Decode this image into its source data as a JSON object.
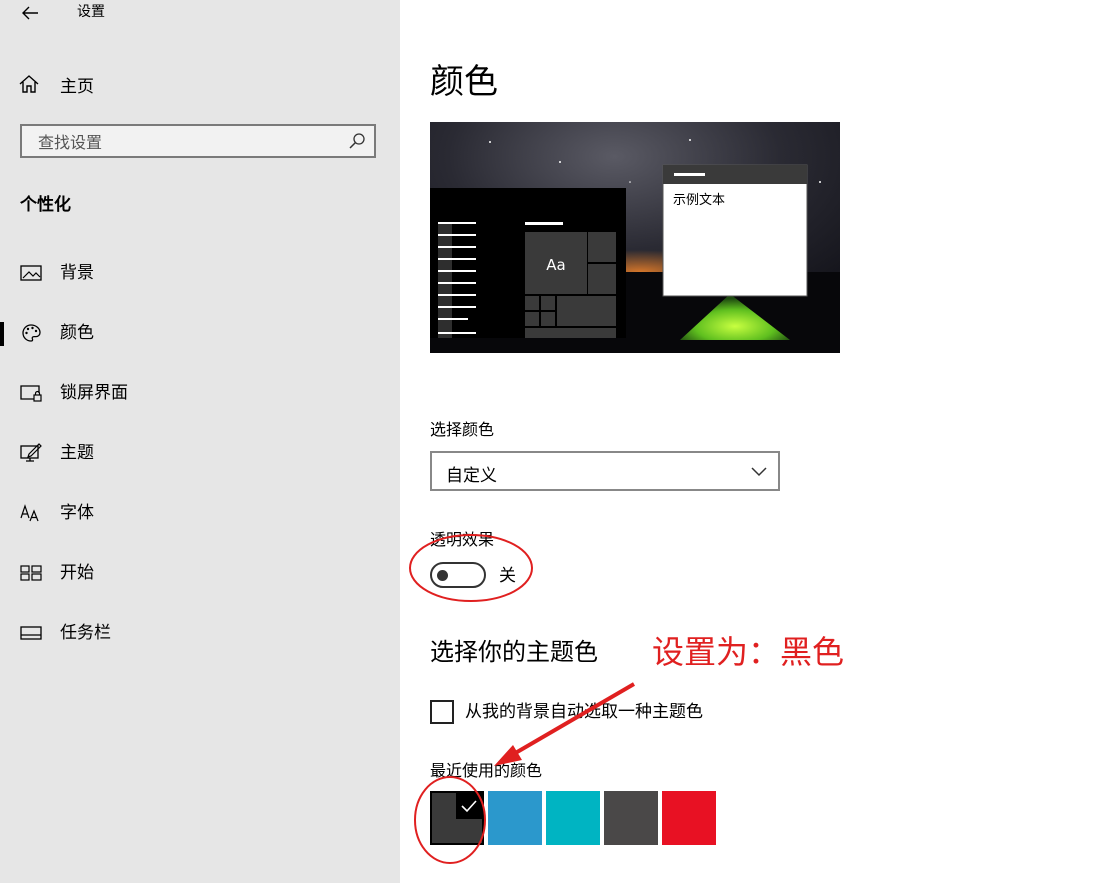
{
  "window": {
    "title": "设置"
  },
  "sidebar": {
    "home_label": "主页",
    "search_placeholder": "查找设置",
    "section_title": "个性化",
    "items": [
      {
        "label": "背景",
        "icon": "image-icon"
      },
      {
        "label": "颜色",
        "icon": "palette-icon",
        "selected": true
      },
      {
        "label": "锁屏界面",
        "icon": "lock-screen-icon"
      },
      {
        "label": "主题",
        "icon": "theme-icon"
      },
      {
        "label": "字体",
        "icon": "font-icon"
      },
      {
        "label": "开始",
        "icon": "start-icon"
      },
      {
        "label": "任务栏",
        "icon": "taskbar-icon"
      }
    ]
  },
  "main": {
    "title": "颜色",
    "preview": {
      "sample_text": "示例文本",
      "tile_text": "Aa"
    },
    "choose_color": {
      "label": "选择颜色",
      "value": "自定义"
    },
    "transparency": {
      "label": "透明效果",
      "state": "关",
      "on": false
    },
    "accent": {
      "heading": "选择你的主题色",
      "auto_label": "从我的背景自动选取一种主题色",
      "auto_checked": false,
      "recent_label": "最近使用的颜色",
      "swatches": [
        "#3a3a3a",
        "#2b98cc",
        "#00b4c2",
        "#4a4848",
        "#e81123"
      ],
      "selected_index": 0
    }
  },
  "annotation": {
    "text": "设置为：黑色",
    "color": "#e02020"
  }
}
